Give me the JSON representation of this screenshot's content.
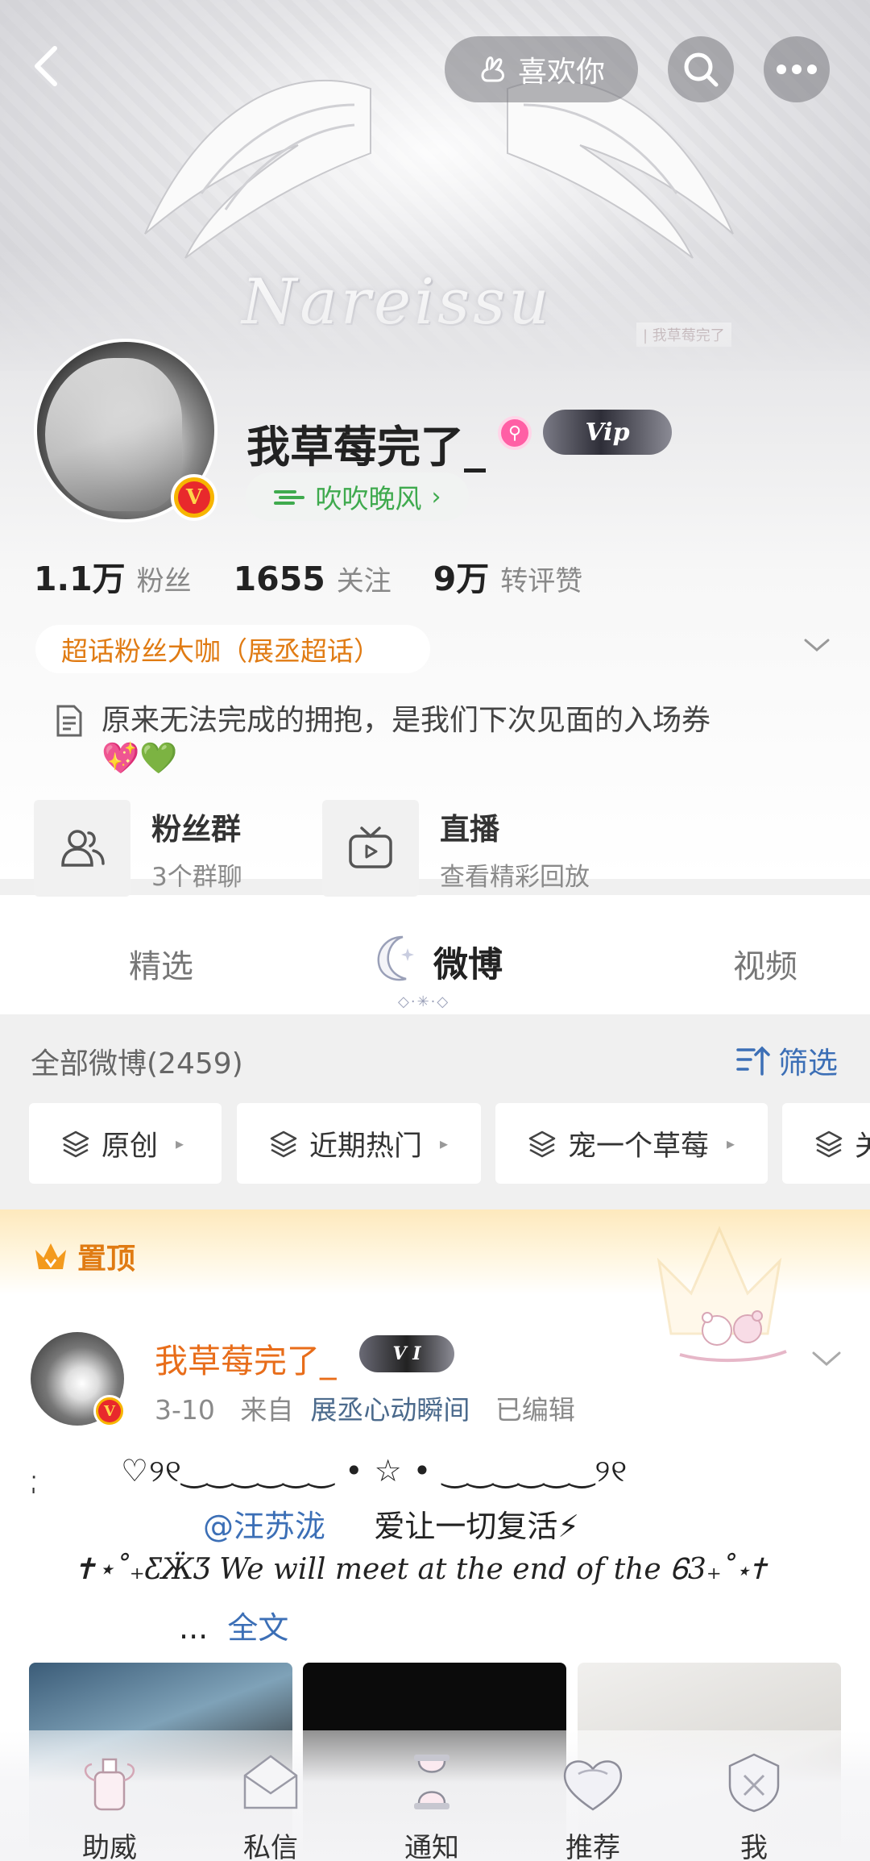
{
  "topbar": {
    "like_label": "喜欢你"
  },
  "banner": {
    "logo_text": "Nareissu",
    "tag_text": "| 我草莓完了"
  },
  "profile": {
    "username": "我草莓完了_",
    "vip_label": "Vip",
    "status_label": "吹吹晚风",
    "stats": [
      {
        "num": "1.1万",
        "label": "粉丝"
      },
      {
        "num": "1655",
        "label": "关注"
      },
      {
        "num": "9万",
        "label": "转评赞"
      }
    ],
    "super_topic": "超话粉丝大咖（展丞超话）",
    "bio": "原来无法完成的拥抱，是我们下次见面的入场券",
    "bio_emoji": "💖💚",
    "features": [
      {
        "title": "粉丝群",
        "sub": "3个群聊",
        "icon": "users-icon"
      },
      {
        "title": "直播",
        "sub": "查看精彩回放",
        "icon": "tv-icon"
      }
    ]
  },
  "tabs": [
    "精选",
    "微博",
    "视频"
  ],
  "filter": {
    "all_label": "全部微博(2459)",
    "filter_label": "筛选",
    "chips": [
      "原创",
      "近期热门",
      "宠一个草莓",
      "关"
    ]
  },
  "post": {
    "pinned_label": "置顶",
    "author": "我草莓完了_",
    "vip_label": "V I",
    "date": "3-10",
    "from_prefix": "来自",
    "source": "展丞心动瞬间",
    "edited": "已编辑",
    "line1": "♡୨୧‿‿‿‿‿‿ • ☆ • ‿‿‿‿‿‿୨୧",
    "mention": "@汪苏泷",
    "line2_rest": "爱让一切复活⚡",
    "line3": "✝⋆˚₊ƸӜƷ We will meet at the end of the Ꮾ3₊˚⋆✝",
    "ellipsis": "...",
    "fulltext": "全文"
  },
  "bottom_nav": [
    {
      "label": "助威",
      "icon": "perfume-icon"
    },
    {
      "label": "私信",
      "icon": "envelope-icon"
    },
    {
      "label": "通知",
      "icon": "hourglass-icon"
    },
    {
      "label": "推荐",
      "icon": "heart-icon"
    },
    {
      "label": "我",
      "icon": "crest-icon"
    }
  ],
  "colors": {
    "accent_orange": "#e07b13",
    "link_blue": "#3c6fb6",
    "status_green": "#3faa4e",
    "pink": "#ff5fa5"
  }
}
